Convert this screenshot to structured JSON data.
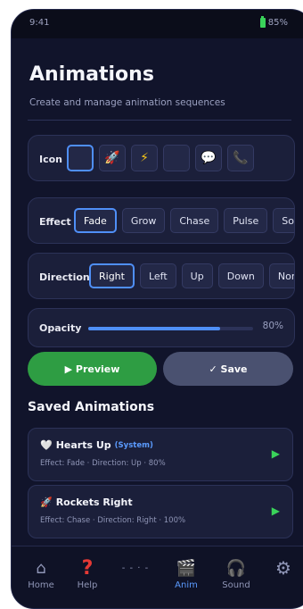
{
  "status": {
    "time": "9:41",
    "battery": "85%"
  },
  "header": {
    "title": "Animations",
    "subtitle": "Create and manage animation sequences"
  },
  "icon_picker": {
    "label": "Icon",
    "items": [
      {
        "name": "blank",
        "glyph": ""
      },
      {
        "name": "rocket",
        "glyph": "🚀"
      },
      {
        "name": "lightning",
        "glyph": "⚡"
      },
      {
        "name": "blank-dark",
        "glyph": ""
      },
      {
        "name": "message",
        "glyph": "💬"
      },
      {
        "name": "phone",
        "glyph": "📞"
      }
    ],
    "selected_index": 0
  },
  "effect": {
    "label": "Effect",
    "options": [
      "Fade",
      "Grow",
      "Chase",
      "Pulse",
      "Solid"
    ],
    "selected": "Fade"
  },
  "direction": {
    "label": "Direction",
    "options": [
      "Right",
      "Left",
      "Up",
      "Down",
      "None"
    ],
    "selected": "Right"
  },
  "opacity": {
    "label": "Opacity",
    "value": 0.8,
    "display": "80%"
  },
  "actions": {
    "preview_label": "▶ Preview",
    "save_label": "✓ Save"
  },
  "saved": {
    "title": "Saved Animations",
    "items": [
      {
        "icon": "🤍",
        "name": "Hearts Up",
        "tag": "(System)",
        "meta": "Effect: Fade · Direction: Up · 80%"
      },
      {
        "icon": "🚀",
        "name": "Rockets Right",
        "tag": "",
        "meta": "Effect: Chase · Direction: Right · 100%"
      }
    ],
    "play_glyph": "▶"
  },
  "tabs": [
    {
      "label": "Home",
      "icon": "⌂"
    },
    {
      "label": "Help",
      "icon": "?"
    },
    {
      "label": "",
      "icon": "- - · -"
    },
    {
      "label": "Anim",
      "icon": "🎬"
    },
    {
      "label": "Sound",
      "icon": "🎧"
    },
    {
      "label": "",
      "icon": "⚙"
    }
  ],
  "colors": {
    "background": "#11142b",
    "accent": "#4f8ff7",
    "preview_green": "#2e9d43",
    "save_gray": "#4a5170",
    "play_green": "#3ad35a",
    "help_red": "#e53935"
  }
}
